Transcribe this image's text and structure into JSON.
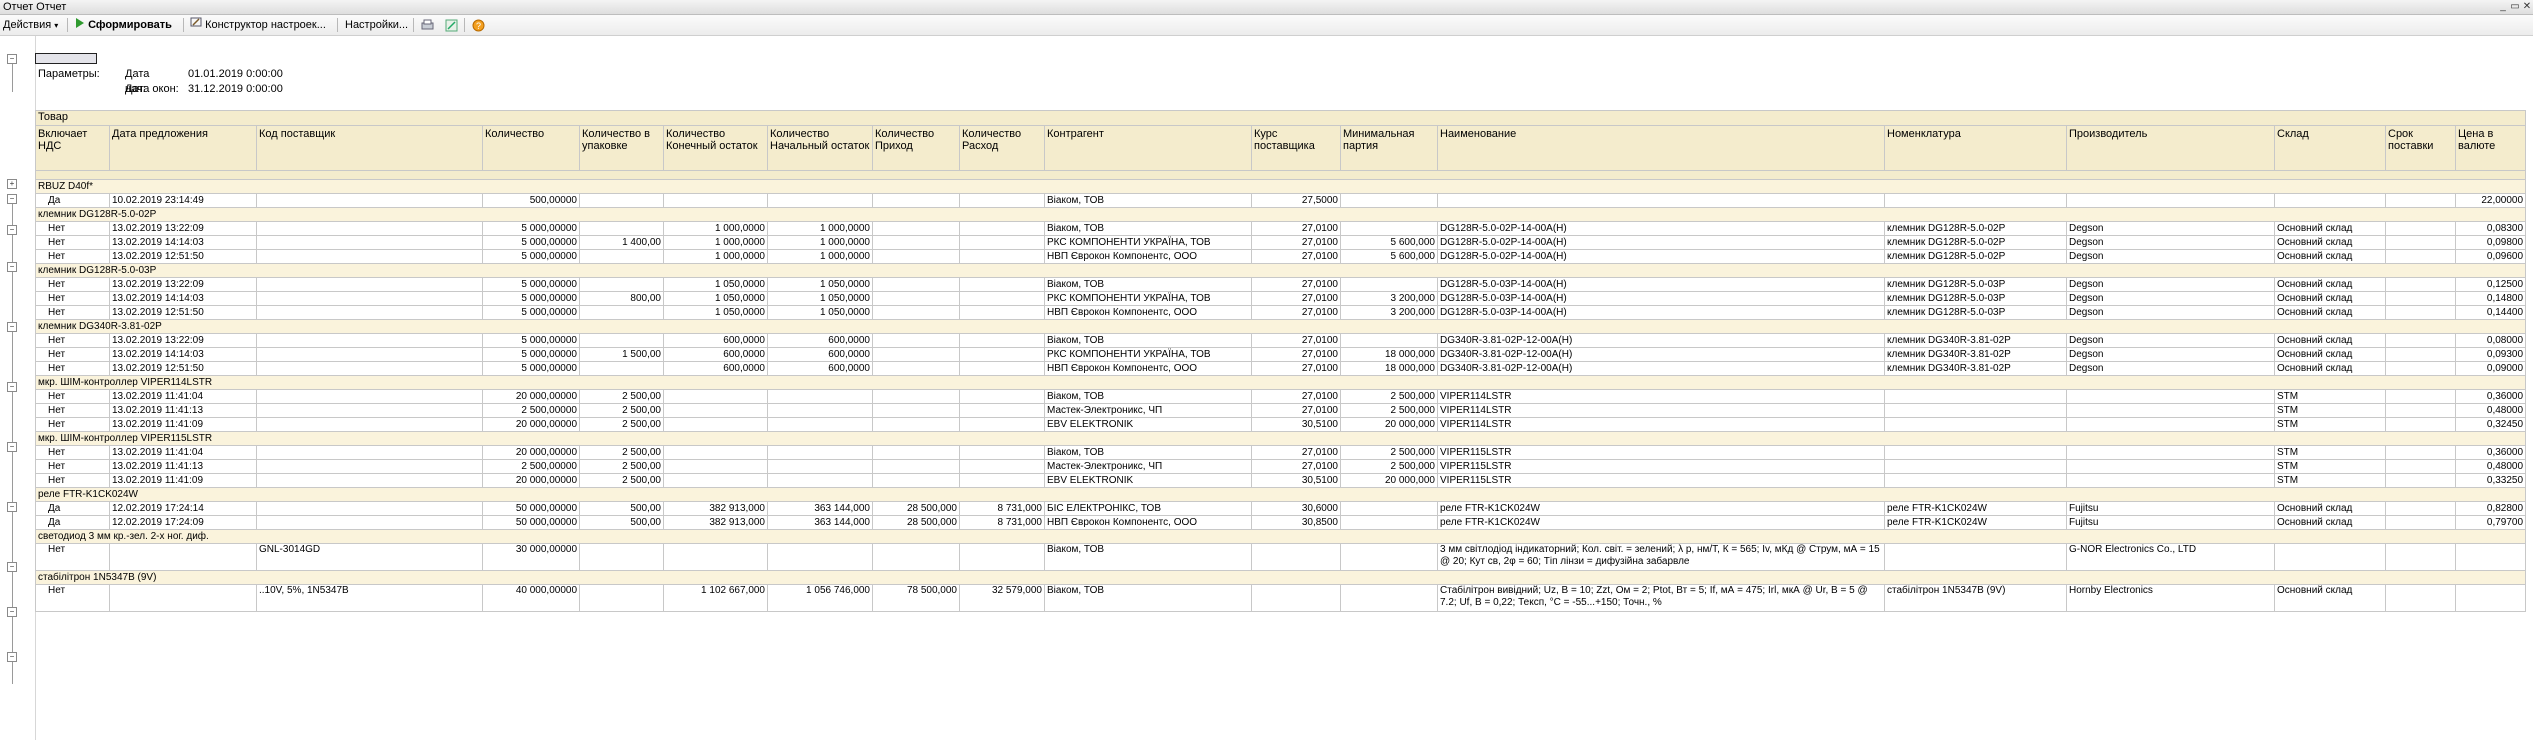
{
  "window": {
    "title": "Отчет  Отчет",
    "controls": [
      "_",
      "▭",
      "✕"
    ]
  },
  "toolbar": {
    "actions": "Действия",
    "generate": "Сформировать",
    "constructor": "Конструктор настроек...",
    "settings": "Настройки..."
  },
  "params": {
    "label": "Параметры:",
    "start_label": "Дата нач:",
    "start_value": "01.01.2019 0:00:00",
    "end_label": "Дата окон:",
    "end_value": "31.12.2019 0:00:00"
  },
  "columns": {
    "group_header": "Товар",
    "names": [
      "Включает НДС",
      "Дата предложения",
      "Код поставщик",
      "Количество",
      "Количество в упаковке",
      "Количество Конечный остаток",
      "Количество Начальный остаток",
      "Количество Приход",
      "Количество Расход",
      "Контрагент",
      "Курс поставщика",
      "Минимальная партия",
      "Наименование",
      "Номенклатура",
      "Производитель",
      "Склад",
      "Срок поставки",
      "Цена в валюте"
    ]
  },
  "groups": [
    {
      "title": "RBUZ D40f*",
      "rows": [
        [
          "Да",
          "10.02.2019 23:14:49",
          "",
          "500,00000",
          "",
          "",
          "",
          "",
          "",
          "Віаком, ТОВ",
          "27,5000",
          "",
          "",
          "",
          "",
          "",
          "",
          "22,00000"
        ]
      ]
    },
    {
      "title": "клемник DG128R-5.0-02P",
      "rows": [
        [
          "Нет",
          "13.02.2019 13:22:09",
          "",
          "5 000,00000",
          "",
          "1 000,0000",
          "1 000,0000",
          "",
          "",
          "Віаком, ТОВ",
          "27,0100",
          "",
          "DG128R-5.0-02P-14-00A(H)",
          "клемник DG128R-5.0-02P",
          "Degson",
          "Основний склад",
          "",
          "0,08300"
        ],
        [
          "Нет",
          "13.02.2019 14:14:03",
          "",
          "5 000,00000",
          "1 400,00",
          "1 000,0000",
          "1 000,0000",
          "",
          "",
          "РКС КОМПОНЕНТИ УКРАЇНА, ТОВ",
          "27,0100",
          "5 600,000",
          "DG128R-5.0-02P-14-00A(H)",
          "клемник DG128R-5.0-02P",
          "Degson",
          "Основний склад",
          "",
          "0,09800"
        ],
        [
          "Нет",
          "13.02.2019 12:51:50",
          "",
          "5 000,00000",
          "",
          "1 000,0000",
          "1 000,0000",
          "",
          "",
          "НВП Єврокон Компонентс, ООО",
          "27,0100",
          "5 600,000",
          "DG128R-5.0-02P-14-00A(H)",
          "клемник DG128R-5.0-02P",
          "Degson",
          "Основний склад",
          "",
          "0,09600"
        ]
      ]
    },
    {
      "title": "клемник DG128R-5.0-03P",
      "rows": [
        [
          "Нет",
          "13.02.2019 13:22:09",
          "",
          "5 000,00000",
          "",
          "1 050,0000",
          "1 050,0000",
          "",
          "",
          "Віаком, ТОВ",
          "27,0100",
          "",
          "DG128R-5.0-03P-14-00A(H)",
          "клемник DG128R-5.0-03P",
          "Degson",
          "Основний склад",
          "",
          "0,12500"
        ],
        [
          "Нет",
          "13.02.2019 14:14:03",
          "",
          "5 000,00000",
          "800,00",
          "1 050,0000",
          "1 050,0000",
          "",
          "",
          "РКС КОМПОНЕНТИ УКРАЇНА, ТОВ",
          "27,0100",
          "3 200,000",
          "DG128R-5.0-03P-14-00A(H)",
          "клемник DG128R-5.0-03P",
          "Degson",
          "Основний склад",
          "",
          "0,14800"
        ],
        [
          "Нет",
          "13.02.2019 12:51:50",
          "",
          "5 000,00000",
          "",
          "1 050,0000",
          "1 050,0000",
          "",
          "",
          "НВП Єврокон Компонентс, ООО",
          "27,0100",
          "3 200,000",
          "DG128R-5.0-03P-14-00A(H)",
          "клемник DG128R-5.0-03P",
          "Degson",
          "Основний склад",
          "",
          "0,14400"
        ]
      ]
    },
    {
      "title": "клемник DG340R-3.81-02P",
      "rows": [
        [
          "Нет",
          "13.02.2019 13:22:09",
          "",
          "5 000,00000",
          "",
          "600,0000",
          "600,0000",
          "",
          "",
          "Віаком, ТОВ",
          "27,0100",
          "",
          "DG340R-3.81-02P-12-00A(H)",
          "клемник DG340R-3.81-02P",
          "Degson",
          "Основний склад",
          "",
          "0,08000"
        ],
        [
          "Нет",
          "13.02.2019 14:14:03",
          "",
          "5 000,00000",
          "1 500,00",
          "600,0000",
          "600,0000",
          "",
          "",
          "РКС КОМПОНЕНТИ УКРАЇНА, ТОВ",
          "27,0100",
          "18 000,000",
          "DG340R-3.81-02P-12-00A(H)",
          "клемник DG340R-3.81-02P",
          "Degson",
          "Основний склад",
          "",
          "0,09300"
        ],
        [
          "Нет",
          "13.02.2019 12:51:50",
          "",
          "5 000,00000",
          "",
          "600,0000",
          "600,0000",
          "",
          "",
          "НВП Єврокон Компонентс, ООО",
          "27,0100",
          "18 000,000",
          "DG340R-3.81-02P-12-00A(H)",
          "клемник DG340R-3.81-02P",
          "Degson",
          "Основний склад",
          "",
          "0,09000"
        ]
      ]
    },
    {
      "title": "мкр. ШІМ-контроллер VIPER114LSTR",
      "rows": [
        [
          "Нет",
          "13.02.2019 11:41:04",
          "",
          "20 000,00000",
          "2 500,00",
          "",
          "",
          "",
          "",
          "Віаком, ТОВ",
          "27,0100",
          "2 500,000",
          "VIPER114LSTR",
          "",
          "",
          "STM",
          "",
          "0,36000"
        ],
        [
          "Нет",
          "13.02.2019 11:41:13",
          "",
          "2 500,00000",
          "2 500,00",
          "",
          "",
          "",
          "",
          "Мастек-Электроникс, ЧП",
          "27,0100",
          "2 500,000",
          "VIPER114LSTR",
          "",
          "",
          "STM",
          "",
          "0,48000"
        ],
        [
          "Нет",
          "13.02.2019 11:41:09",
          "",
          "20 000,00000",
          "2 500,00",
          "",
          "",
          "",
          "",
          "EBV ELEKTRONIK",
          "30,5100",
          "20 000,000",
          "VIPER114LSTR",
          "",
          "",
          "STM",
          "",
          "0,32450"
        ]
      ]
    },
    {
      "title": "мкр. ШІМ-контроллер VIPER115LSTR",
      "rows": [
        [
          "Нет",
          "13.02.2019 11:41:04",
          "",
          "20 000,00000",
          "2 500,00",
          "",
          "",
          "",
          "",
          "Віаком, ТОВ",
          "27,0100",
          "2 500,000",
          "VIPER115LSTR",
          "",
          "",
          "STM",
          "",
          "0,36000"
        ],
        [
          "Нет",
          "13.02.2019 11:41:13",
          "",
          "2 500,00000",
          "2 500,00",
          "",
          "",
          "",
          "",
          "Мастек-Электроникс, ЧП",
          "27,0100",
          "2 500,000",
          "VIPER115LSTR",
          "",
          "",
          "STM",
          "",
          "0,48000"
        ],
        [
          "Нет",
          "13.02.2019 11:41:09",
          "",
          "20 000,00000",
          "2 500,00",
          "",
          "",
          "",
          "",
          "EBV ELEKTRONIK",
          "30,5100",
          "20 000,000",
          "VIPER115LSTR",
          "",
          "",
          "STM",
          "",
          "0,33250"
        ]
      ]
    },
    {
      "title": "реле FTR-K1CK024W",
      "rows": [
        [
          "Да",
          "12.02.2019 17:24:14",
          "",
          "50 000,00000",
          "500,00",
          "382 913,000",
          "363 144,000",
          "28 500,000",
          "8 731,000",
          "БІС ЕЛЕКТРОНІКС, ТОВ",
          "30,6000",
          "",
          "реле FTR-K1CK024W",
          "реле FTR-K1CK024W",
          "Fujitsu",
          "Основний склад",
          "",
          "0,82800"
        ],
        [
          "Да",
          "12.02.2019 17:24:09",
          "",
          "50 000,00000",
          "500,00",
          "382 913,000",
          "363 144,000",
          "28 500,000",
          "8 731,000",
          "НВП Єврокон Компонентс, ООО",
          "30,8500",
          "",
          "реле FTR-K1CK024W",
          "реле FTR-K1CK024W",
          "Fujitsu",
          "Основний склад",
          "",
          "0,79700"
        ]
      ]
    },
    {
      "title": "светодиод 3 мм кр.-зел. 2-х ног. диф.",
      "rows": [
        [
          "Нет",
          "",
          "GNL-3014GD",
          "30 000,00000",
          "",
          "",
          "",
          "",
          "",
          "Віаком, ТОВ",
          "",
          "",
          "3 мм світлодіод індикаторний; Кол. світ. = зелений; λ р, нм/Т, К = 565; Iv, мКд @ Струм, мА = 15 @ 20; Кут св, 2φ = 60; Тіп лінзи = дифузійна забарвле",
          "",
          "G-NOR Electronics Co., LTD",
          "",
          "",
          ""
        ]
      ]
    },
    {
      "title": "стабілітрон 1N5347B (9V)",
      "rows": [
        [
          "Нет",
          "",
          "..10V, 5%, 1N5347B",
          "40 000,00000",
          "",
          "1 102 667,000",
          "1 056 746,000",
          "78 500,000",
          "32 579,000",
          "Віаком, ТОВ",
          "",
          "",
          "Стабілітрон вивідний; Uz, B = 10; Zzt, Ом = 2; Ptot, Вт = 5; If, мА = 475; Irl, мкА @  Ur, B = 5 @ 7.2; Uf, B = 0,22; Тексп, °C = -55...+150; Точн., %",
          "стабілітрон 1N5347B (9V)",
          "Hornby Electronics",
          "Основний склад",
          "",
          ""
        ]
      ]
    }
  ]
}
